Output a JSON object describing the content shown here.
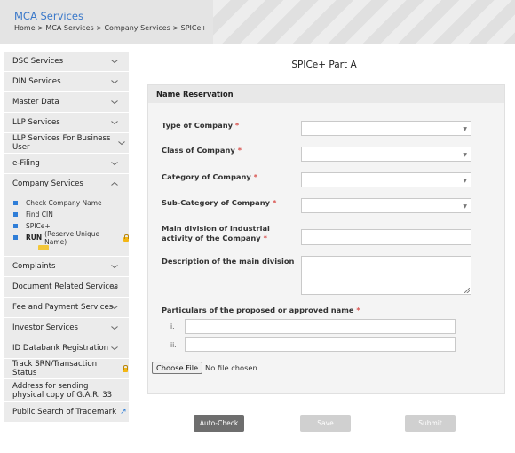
{
  "header": {
    "title": "MCA Services",
    "breadcrumb": [
      "Home",
      "MCA Services",
      "Company Services",
      "SPICe+"
    ],
    "separator": ">"
  },
  "sidebar": {
    "items_top": [
      {
        "label": "DSC Services"
      },
      {
        "label": "DIN Services"
      },
      {
        "label": "Master Data"
      },
      {
        "label": "LLP Services"
      },
      {
        "label": "LLP Services For Business User"
      },
      {
        "label": "e-Filing"
      },
      {
        "label": "Company Services",
        "expanded": true
      }
    ],
    "company_sub": [
      {
        "label": "Check Company Name"
      },
      {
        "label": "Find CIN"
      },
      {
        "label": "SPICe+",
        "active": true
      },
      {
        "label_bold": "RUN",
        "label": "(Reserve Unique Name)",
        "locked": true,
        "new_badge": true
      }
    ],
    "items_bottom": [
      {
        "label": "Complaints"
      },
      {
        "label": "Document Related Services"
      },
      {
        "label": "Fee and Payment Services"
      },
      {
        "label": "Investor Services"
      },
      {
        "label": "ID Databank Registration"
      },
      {
        "label": "Track SRN/Transaction Status",
        "locked": true
      },
      {
        "label": "Address for sending physical copy of G.A.R. 33"
      },
      {
        "label": "Public Search of Trademark",
        "external": true
      }
    ]
  },
  "main": {
    "title": "SPICe+ Part A",
    "section_title": "Name Reservation",
    "required_mark": "*",
    "fields": {
      "type_of_company": "Type of Company",
      "class_of_company": "Class of Company",
      "category_of_company": "Category of Company",
      "sub_category_of_company": "Sub-Category of Company",
      "main_division_l1": "Main division of industrial",
      "main_division_l2": "activity of the Company",
      "description_main_division": "Description of the main division",
      "particulars": "Particulars of the proposed or approved name"
    },
    "name_rows": [
      "i.",
      "ii."
    ],
    "file": {
      "button": "Choose File",
      "status": "No file chosen"
    },
    "buttons": {
      "auto_check": "Auto-Check",
      "save": "Save",
      "submit": "Submit"
    }
  },
  "colors": {
    "accent": "#3a78c9",
    "bullet": "#2f7ed8",
    "required": "#d9534f",
    "lock": "#f3b614"
  }
}
